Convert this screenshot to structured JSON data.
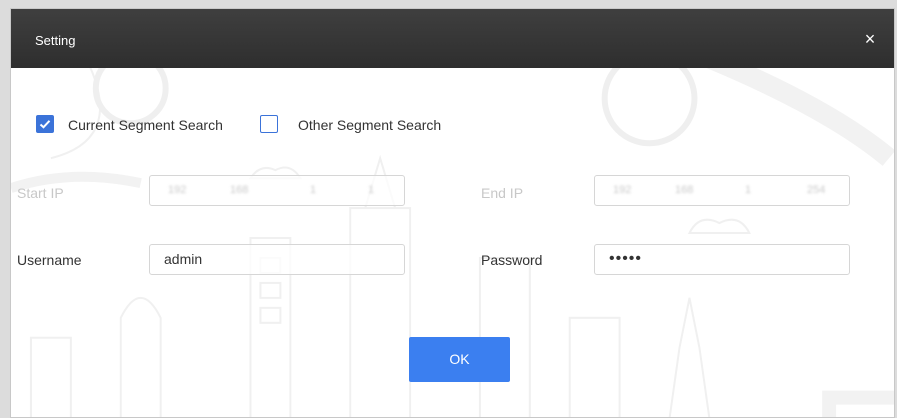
{
  "dialog": {
    "title": "Setting",
    "close_symbol": "×"
  },
  "search_mode": {
    "current": {
      "label": "Current Segment Search",
      "checked": true
    },
    "other": {
      "label": "Other Segment Search",
      "checked": false
    }
  },
  "start_ip": {
    "label": "Start IP",
    "segments": [
      "192",
      "168",
      "1",
      "1"
    ],
    "disabled": true
  },
  "end_ip": {
    "label": "End IP",
    "segments": [
      "192",
      "168",
      "1",
      "254"
    ],
    "disabled": true
  },
  "username": {
    "label": "Username",
    "value": "admin"
  },
  "password": {
    "label": "Password",
    "value": "•••••"
  },
  "ok_button": {
    "label": "OK"
  },
  "colors": {
    "accent": "#3b7ff0",
    "checkbox": "#3b73d9",
    "titlebar": "#333333"
  },
  "icons": {
    "close": "close-icon",
    "check": "check-icon"
  }
}
